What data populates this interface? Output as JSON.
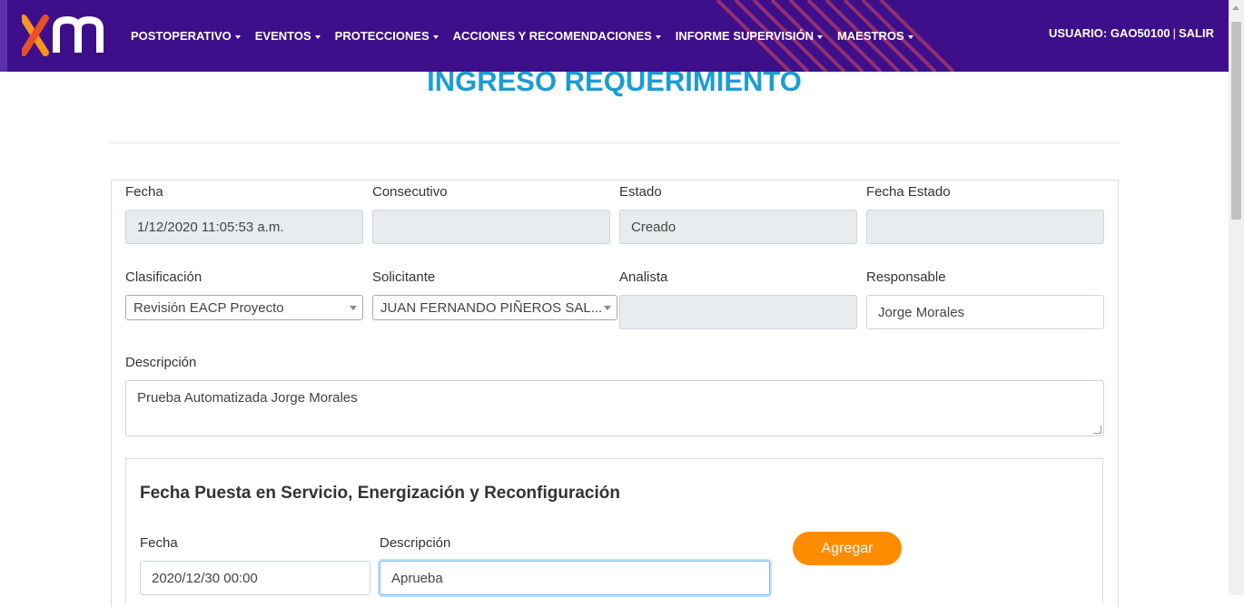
{
  "nav": {
    "logo_alt": "xm",
    "menu": [
      "POSTOPERATIVO",
      "EVENTOS",
      "PROTECCIONES",
      "ACCIONES Y RECOMENDACIONES",
      "INFORME SUPERVISIÓN",
      "MAESTROS"
    ],
    "user_label": "USUARIO: GAO50100",
    "separator": "|",
    "logout": "SALIR"
  },
  "colors": {
    "navbar": "#3d0f8a",
    "title": "#1a9dd3",
    "accent": "#ff8c00"
  },
  "page": {
    "title": "INGRESO REQUERIMIENTO"
  },
  "form": {
    "fecha": {
      "label": "Fecha",
      "value": "1/12/2020 11:05:53 a.m."
    },
    "consecutivo": {
      "label": "Consecutivo",
      "value": ""
    },
    "estado": {
      "label": "Estado",
      "value": "Creado"
    },
    "fecha_estado": {
      "label": "Fecha Estado",
      "value": ""
    },
    "clasificacion": {
      "label": "Clasificación",
      "value": "Revisión EACP Proyecto"
    },
    "solicitante": {
      "label": "Solicitante",
      "value": "JUAN FERNANDO PIÑEROS SAL..."
    },
    "analista": {
      "label": "Analista",
      "value": ""
    },
    "responsable": {
      "label": "Responsable",
      "value": "Jorge Morales"
    },
    "descripcion": {
      "label": "Descripción",
      "value": "Prueba Automatizada Jorge Morales"
    }
  },
  "section": {
    "title": "Fecha Puesta en Servicio, Energización y Reconfiguración",
    "fecha": {
      "label": "Fecha",
      "value": "2020/12/30 00:00"
    },
    "descripcion": {
      "label": "Descripción",
      "value": "Aprueba"
    },
    "add_button": "Agregar"
  }
}
